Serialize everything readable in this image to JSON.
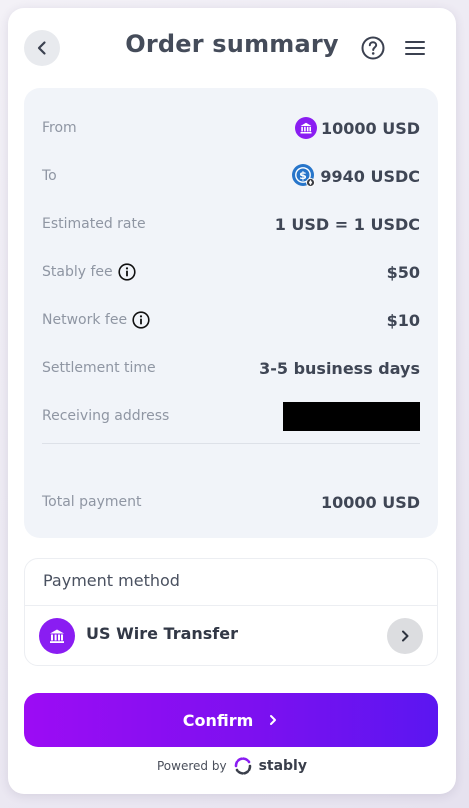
{
  "header": {
    "title": "Order summary"
  },
  "summary": {
    "from_label": "From",
    "from_value": "10000 USD",
    "to_label": "To",
    "to_value": "9940 USDC",
    "rate_label": "Estimated rate",
    "rate_value": "1 USD = 1 USDC",
    "stably_fee_label": "Stably fee",
    "stably_fee_value": "$50",
    "network_fee_label": "Network fee",
    "network_fee_value": "$10",
    "settlement_label": "Settlement time",
    "settlement_value": "3-5 business days",
    "receiving_label": "Receiving address",
    "total_label": "Total payment",
    "total_value": "10000 USD"
  },
  "payment": {
    "title": "Payment method",
    "method": "US Wire Transfer"
  },
  "confirm_label": "Confirm",
  "footer": {
    "powered_by": "Powered by",
    "brand": "stably"
  },
  "colors": {
    "accent": "#8a1df2",
    "usdc": "#2775ca"
  }
}
